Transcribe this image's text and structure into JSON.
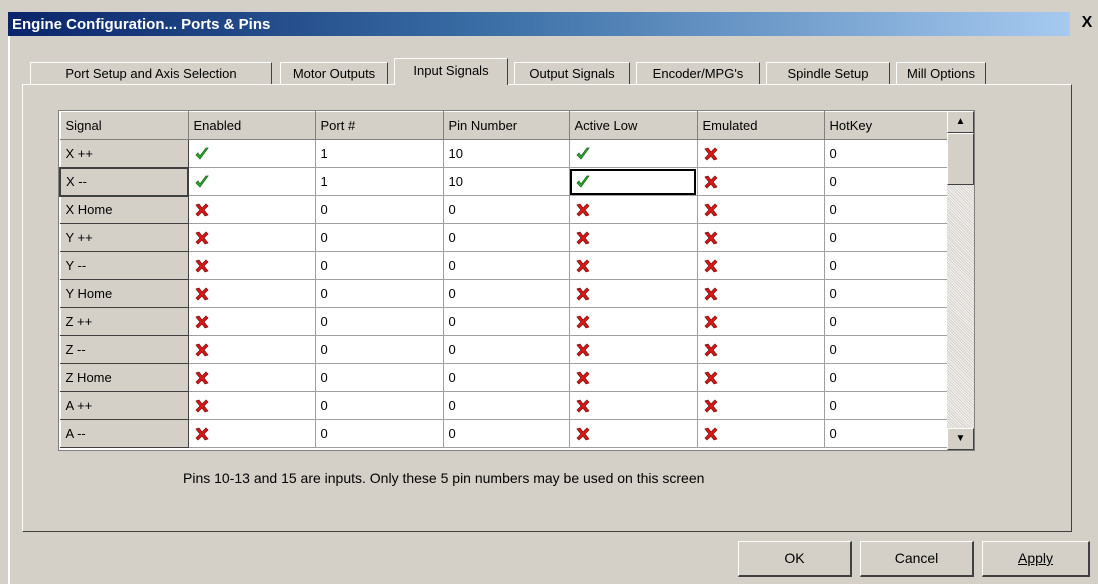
{
  "window": {
    "title": "Engine Configuration... Ports & Pins",
    "close_label": "X"
  },
  "tabs": [
    {
      "label": "Port Setup and Axis Selection",
      "active": false
    },
    {
      "label": "Motor Outputs",
      "active": false
    },
    {
      "label": "Input Signals",
      "active": true
    },
    {
      "label": "Output Signals",
      "active": false
    },
    {
      "label": "Encoder/MPG's",
      "active": false
    },
    {
      "label": "Spindle Setup",
      "active": false
    },
    {
      "label": "Mill Options",
      "active": false
    }
  ],
  "grid": {
    "columns": [
      "Signal",
      "Enabled",
      "Port #",
      "Pin Number",
      "Active Low",
      "Emulated",
      "HotKey"
    ],
    "rows": [
      {
        "signal": "X ++",
        "enabled": true,
        "port": "1",
        "pin": "10",
        "active_low": true,
        "emulated": false,
        "hotkey": "0"
      },
      {
        "signal": "X --",
        "enabled": true,
        "port": "1",
        "pin": "10",
        "active_low": true,
        "emulated": false,
        "hotkey": "0"
      },
      {
        "signal": "X Home",
        "enabled": false,
        "port": "0",
        "pin": "0",
        "active_low": false,
        "emulated": false,
        "hotkey": "0"
      },
      {
        "signal": "Y ++",
        "enabled": false,
        "port": "0",
        "pin": "0",
        "active_low": false,
        "emulated": false,
        "hotkey": "0"
      },
      {
        "signal": "Y --",
        "enabled": false,
        "port": "0",
        "pin": "0",
        "active_low": false,
        "emulated": false,
        "hotkey": "0"
      },
      {
        "signal": "Y Home",
        "enabled": false,
        "port": "0",
        "pin": "0",
        "active_low": false,
        "emulated": false,
        "hotkey": "0"
      },
      {
        "signal": "Z ++",
        "enabled": false,
        "port": "0",
        "pin": "0",
        "active_low": false,
        "emulated": false,
        "hotkey": "0"
      },
      {
        "signal": "Z --",
        "enabled": false,
        "port": "0",
        "pin": "0",
        "active_low": false,
        "emulated": false,
        "hotkey": "0"
      },
      {
        "signal": "Z Home",
        "enabled": false,
        "port": "0",
        "pin": "0",
        "active_low": false,
        "emulated": false,
        "hotkey": "0"
      },
      {
        "signal": "A ++",
        "enabled": false,
        "port": "0",
        "pin": "0",
        "active_low": false,
        "emulated": false,
        "hotkey": "0"
      },
      {
        "signal": "A --",
        "enabled": false,
        "port": "0",
        "pin": "0",
        "active_low": false,
        "emulated": false,
        "hotkey": "0"
      }
    ],
    "focused_row": 1,
    "selected_cell": {
      "row": 1,
      "column": "Active Low"
    },
    "icons": {
      "true": "green-check-icon",
      "false": "red-x-icon"
    }
  },
  "note": "Pins 10-13 and 15 are inputs. Only these 5 pin numbers may be used on this screen",
  "buttons": {
    "ok": "OK",
    "cancel": "Cancel",
    "apply": "Apply"
  },
  "colors": {
    "title_start": "#0a246a",
    "title_end": "#a6caf0",
    "check": "#2fae2f",
    "cross": "#d81818"
  }
}
